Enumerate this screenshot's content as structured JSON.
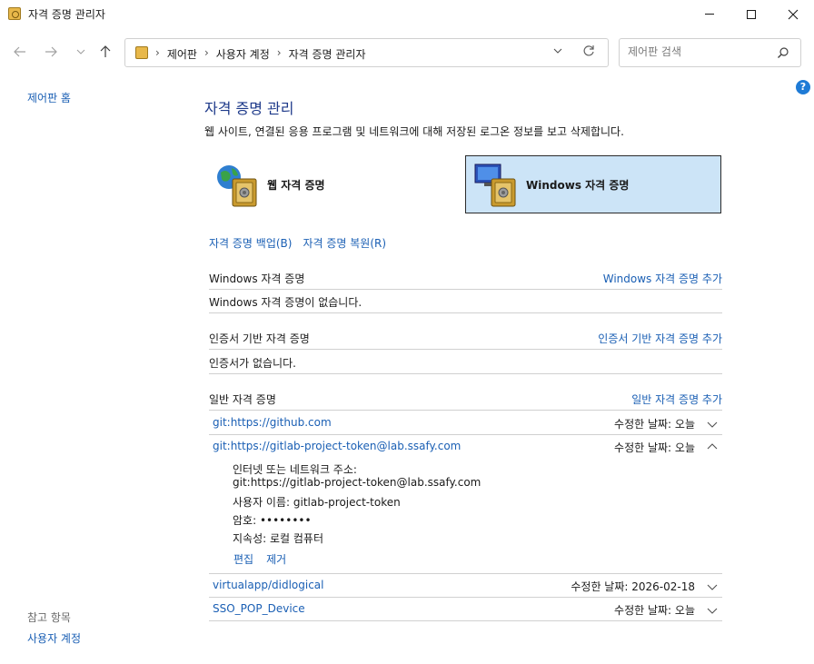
{
  "window": {
    "title": "자격 증명 관리자"
  },
  "address": {
    "breadcrumbs": [
      "제어판",
      "사용자 계정",
      "자격 증명 관리자"
    ],
    "search_placeholder": "제어판 검색"
  },
  "left": {
    "home_link": "제어판 홈",
    "see_also": "참고 항목",
    "user_accounts": "사용자 계정"
  },
  "main": {
    "title": "자격 증명 관리",
    "description": "웹 사이트, 연결된 응용 프로그램 및 네트워크에 대해 저장된 로그온 정보를 보고 삭제합니다.",
    "tiles": {
      "web": "웹 자격 증명",
      "windows": "Windows 자격 증명",
      "selected": "windows"
    },
    "backup_link": "자격 증명 백업(B)",
    "restore_link": "자격 증명 복원(R)",
    "sections": {
      "windows": {
        "heading": "Windows 자격 증명",
        "add": "Windows 자격 증명 추가",
        "empty": "Windows 자격 증명이 없습니다."
      },
      "cert": {
        "heading": "인증서 기반 자격 증명",
        "add": "인증서 기반 자격 증명 추가",
        "empty": "인증서가 없습니다."
      },
      "generic": {
        "heading": "일반 자격 증명",
        "add": "일반 자격 증명 추가"
      }
    },
    "credentials": [
      {
        "name": "git:https://github.com",
        "modified": "수정한 날짜:  오늘",
        "expanded": false
      },
      {
        "name": "git:https://gitlab-project-token@lab.ssafy.com",
        "modified": "수정한 날짜:  오늘",
        "expanded": true
      },
      {
        "name": "virtualapp/didlogical",
        "modified": "수정한 날짜:  2026-02-18",
        "expanded": false
      },
      {
        "name": "SSO_POP_Device",
        "modified": "수정한 날짜:  오늘",
        "expanded": false
      }
    ],
    "detail": {
      "address_label": "인터넷 또는 네트워크 주소:",
      "address_value": "git:https://gitlab-project-token@lab.ssafy.com",
      "user_line": "사용자 이름:  gitlab-project-token",
      "password_line": "암호:  ••••••••",
      "persistence_line": "지속성:  로컬 컴퓨터",
      "edit": "편집",
      "remove": "제거"
    }
  }
}
